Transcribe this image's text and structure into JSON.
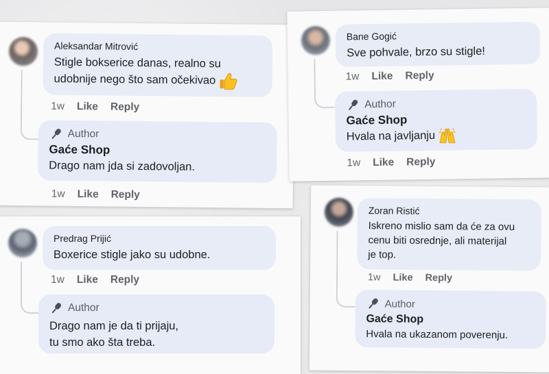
{
  "comments": [
    {
      "author": "Aleksandar Mitrović",
      "text_line1": "Stigle bokserice danas, realno su",
      "text_line2": "udobnije nego što sam očekivao",
      "emoji": "thumbs-up",
      "time": "1w",
      "like": "Like",
      "reply": "Reply",
      "response": {
        "badge": "Author",
        "shop": "Gaće Shop",
        "text": "Drago nam jda si zadovoljan.",
        "time": "1w",
        "like": "Like",
        "reply": "Reply"
      }
    },
    {
      "author": "Bane Gogić",
      "text": "Sve pohvale, brzo su stigle!",
      "time": "1w",
      "like": "Like",
      "reply": "Reply",
      "response": {
        "badge": "Author",
        "shop": "Gaće Shop",
        "text": "Hvala na javljanju",
        "emoji": "raising-hands",
        "time": "1w",
        "like": "Like",
        "reply": "Reply"
      }
    },
    {
      "author": "Predrag Prijić",
      "text": "Boxerice stigle jako su udobne.",
      "time": "1w",
      "like": "Like",
      "reply": "Reply",
      "response": {
        "badge": "Author",
        "text_line1": "Drago nam je da ti prijaju,",
        "text_line2": "tu smo ako šta treba."
      }
    },
    {
      "author": "Zoran Ristić",
      "text_line1": "Iskreno mislio sam da će za ovu",
      "text_line2": "cenu biti osrednje, ali materijal",
      "text_line3": "je top.",
      "time": "1w",
      "like": "Like",
      "reply": "Reply",
      "response": {
        "badge": "Author",
        "shop": "Gaće Shop",
        "text": "Hvala na ukazanom poverenju."
      }
    }
  ],
  "icons": {
    "author_badge": "microphone-icon"
  },
  "colors": {
    "bubble": "#e8ecf6",
    "text": "#1c1e21",
    "meta": "#65676b"
  }
}
